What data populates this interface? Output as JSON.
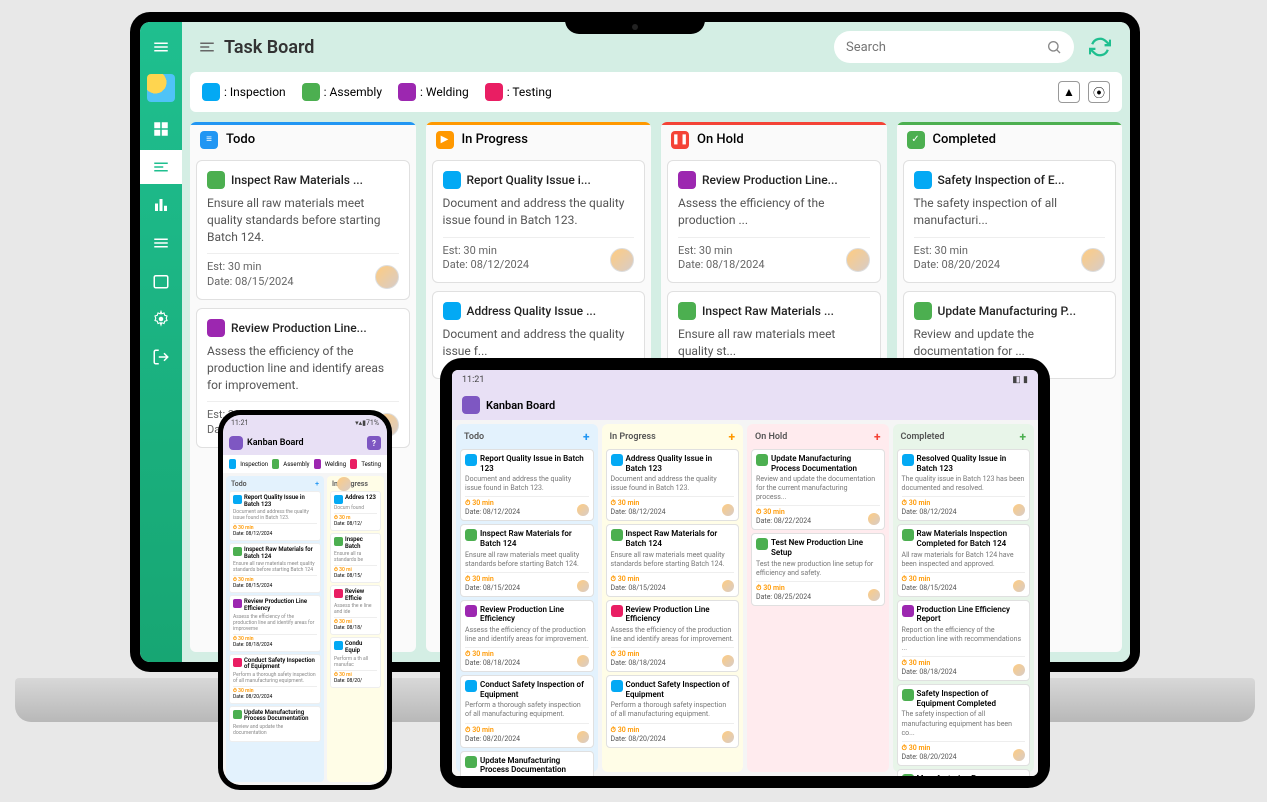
{
  "desktop": {
    "title": "Task Board",
    "search_placeholder": "Search",
    "legend": {
      "inspection": ": Inspection",
      "assembly": ": Assembly",
      "welding": ": Welding",
      "testing": ": Testing"
    },
    "columns": {
      "todo": "Todo",
      "progress": "In Progress",
      "hold": "On Hold",
      "done": "Completed"
    },
    "cards": {
      "todo": [
        {
          "tag": "assembly",
          "title": "Inspect Raw Materials ...",
          "desc": "Ensure all raw materials meet quality standards before starting Batch 124.",
          "est": "Est: 30 min",
          "date": "Date: 08/15/2024"
        },
        {
          "tag": "welding",
          "title": "Review Production Line...",
          "desc": "Assess the efficiency of the production line and identify areas for improvement.",
          "est": "Est: 30 min",
          "date": "Date: 08/18/2024"
        }
      ],
      "progress": [
        {
          "tag": "inspection",
          "title": "Report Quality Issue i...",
          "desc": "Document and address the quality issue found in Batch 123.",
          "est": "Est: 30 min",
          "date": "Date: 08/12/2024"
        },
        {
          "tag": "inspection",
          "title": "Address Quality Issue ...",
          "desc": "Document and address the quality issue f...",
          "est": "",
          "date": ""
        }
      ],
      "hold": [
        {
          "tag": "welding",
          "title": "Review Production Line...",
          "desc": "Assess the efficiency of the production ...",
          "est": "Est: 30 min",
          "date": "Date: 08/18/2024"
        },
        {
          "tag": "assembly",
          "title": "Inspect Raw Materials ...",
          "desc": "Ensure all raw materials meet quality st...",
          "est": "",
          "date": ""
        }
      ],
      "done": [
        {
          "tag": "inspection",
          "title": "Safety Inspection of E...",
          "desc": "The safety inspection of all manufacturi...",
          "est": "Est: 30 min",
          "date": "Date: 08/20/2024"
        },
        {
          "tag": "assembly",
          "title": "Update Manufacturing P...",
          "desc": "Review and update the documentation for ...",
          "est": "",
          "date": ""
        }
      ]
    }
  },
  "tablet": {
    "time": "11:21",
    "title": "Kanban Board",
    "columns": {
      "todo": "Todo",
      "progress": "In Progress",
      "hold": "On Hold",
      "done": "Completed"
    },
    "cards": {
      "todo": [
        {
          "tag": "inspection",
          "title": "Report Quality Issue in Batch 123",
          "desc": "Document and address the quality issue found in Batch 123.",
          "est": "⏱ 30 min",
          "date": "Date: 08/12/2024"
        },
        {
          "tag": "assembly",
          "title": "Inspect Raw Materials for Batch 124",
          "desc": "Ensure all raw materials meet quality standards before starting Batch 124.",
          "est": "⏱ 30 min",
          "date": "Date: 08/15/2024"
        },
        {
          "tag": "welding",
          "title": "Review Production Line Efficiency",
          "desc": "Assess the efficiency of the production line and identify areas for improvement.",
          "est": "⏱ 30 min",
          "date": "Date: 08/18/2024"
        },
        {
          "tag": "inspection",
          "title": "Conduct Safety Inspection of Equipment",
          "desc": "Perform a thorough safety inspection of all manufacturing equipment.",
          "est": "⏱ 30 min",
          "date": "Date: 08/20/2024"
        },
        {
          "tag": "assembly",
          "title": "Update Manufacturing Process Documentation",
          "desc": "",
          "est": "",
          "date": ""
        }
      ],
      "progress": [
        {
          "tag": "inspection",
          "title": "Address Quality Issue in Batch 123",
          "desc": "Document and address the quality issue found in Batch 123.",
          "est": "⏱ 30 min",
          "date": "Date: 08/12/2024"
        },
        {
          "tag": "assembly",
          "title": "Inspect Raw Materials for Batch 124",
          "desc": "Ensure all raw materials meet quality standards before starting Batch 124.",
          "est": "⏱ 30 min",
          "date": "Date: 08/15/2024"
        },
        {
          "tag": "testing",
          "title": "Review Production Line Efficiency",
          "desc": "Assess the efficiency of the production line and identify areas for improvement.",
          "est": "⏱ 30 min",
          "date": "Date: 08/18/2024"
        },
        {
          "tag": "inspection",
          "title": "Conduct Safety Inspection of Equipment",
          "desc": "Perform a thorough safety inspection of all manufacturing equipment.",
          "est": "⏱ 30 min",
          "date": "Date: 08/20/2024"
        }
      ],
      "hold": [
        {
          "tag": "assembly",
          "title": "Update Manufacturing Process Documentation",
          "desc": "Review and update the documentation for the current manufacturing process...",
          "est": "⏱ 30 min",
          "date": "Date: 08/22/2024"
        },
        {
          "tag": "assembly",
          "title": "Test New Production Line Setup",
          "desc": "Test the new production line setup for efficiency and safety.",
          "est": "⏱ 30 min",
          "date": "Date: 08/25/2024"
        }
      ],
      "done": [
        {
          "tag": "inspection",
          "title": "Resolved Quality Issue in Batch 123",
          "desc": "The quality issue in Batch 123 has been documented and resolved.",
          "est": "⏱ 30 min",
          "date": "Date: 08/12/2024"
        },
        {
          "tag": "assembly",
          "title": "Raw Materials Inspection Completed for Batch 124",
          "desc": "All raw materials for Batch 124 have been inspected and approved.",
          "est": "⏱ 30 min",
          "date": "Date: 08/15/2024"
        },
        {
          "tag": "welding",
          "title": "Production Line Efficiency Report",
          "desc": "Report on the efficiency of the production line with recommendations ...",
          "est": "⏱ 30 min",
          "date": "Date: 08/18/2024"
        },
        {
          "tag": "assembly",
          "title": "Safety Inspection of Equipment Completed",
          "desc": "The safety inspection of all manufacturing equipment has been co...",
          "est": "⏱ 30 min",
          "date": "Date: 08/20/2024"
        },
        {
          "tag": "assembly",
          "title": "Manufacturing Process Documentation Updated",
          "desc": "",
          "est": "",
          "date": ""
        }
      ]
    }
  },
  "phone": {
    "time": "11:21",
    "battery": "71%",
    "title": "Kanban Board",
    "legend": {
      "inspection": "Inspection",
      "assembly": "Assembly",
      "welding": "Welding",
      "testing": "Testing"
    },
    "columns": {
      "todo": "Todo",
      "progress": "In Progress"
    },
    "cards": {
      "todo": [
        {
          "tag": "inspection",
          "title": "Report Quality Issue in Batch 123",
          "desc": "Document and address the quality issue found in Batch 123.",
          "est": "⏱ 30 min",
          "date": "Date: 08/12/2024"
        },
        {
          "tag": "assembly",
          "title": "Inspect Raw Materials for Batch 124",
          "desc": "Ensure all raw materials meet quality standards before starting Batch 124",
          "est": "⏱ 30 min",
          "date": "Date: 08/15/2024"
        },
        {
          "tag": "welding",
          "title": "Review Production Line Efficiency",
          "desc": "Assess the efficiency of the production line and identify areas for improveme",
          "est": "⏱ 30 min",
          "date": "Date: 08/18/2024"
        },
        {
          "tag": "testing",
          "title": "Conduct Safety Inspection of Equipment",
          "desc": "Perform a thorough safety inspection of all manufacturing equipment.",
          "est": "⏱ 30 min",
          "date": "Date: 08/20/2024"
        },
        {
          "tag": "assembly",
          "title": "Update Manufacturing Process Documentation",
          "desc": "Review and update the documentation",
          "est": "",
          "date": ""
        }
      ],
      "progress": [
        {
          "tag": "inspection",
          "title": "Addres 123",
          "desc": "Docum found",
          "est": "⏱ 30 m",
          "date": "Date: 08/12/"
        },
        {
          "tag": "assembly",
          "title": "Inspec Batch",
          "desc": "Ensure all ra standards be",
          "est": "⏱ 30 mi",
          "date": "Date: 08/15/"
        },
        {
          "tag": "testing",
          "title": "Review Efficie",
          "desc": "Assess the e line and ide",
          "est": "⏱ 30 mi",
          "date": "Date: 08/18/"
        },
        {
          "tag": "inspection",
          "title": "Condu Equip",
          "desc": "Perform a th all manufac",
          "est": "⏱ 30 mi",
          "date": "Date: 08/20/"
        }
      ]
    }
  }
}
